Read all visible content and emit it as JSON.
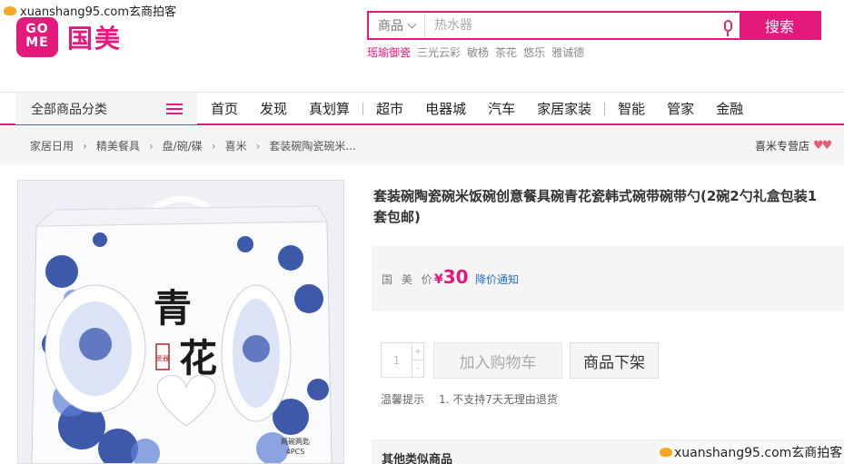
{
  "watermark": {
    "text": "xuanshang95.com玄商拍客"
  },
  "logo": {
    "box_top": "GO",
    "box_bottom": "ME",
    "name": "国美"
  },
  "search": {
    "category": "商品",
    "placeholder": "热水器",
    "button": "搜索"
  },
  "hot_keywords": [
    "瑶瑜御瓷",
    "三光云彩",
    "敏杨",
    "茶花",
    "悠乐",
    "雅诚德"
  ],
  "nav": {
    "all_categories": "全部商品分类",
    "items": [
      "首页",
      "发现",
      "真划算",
      "超市",
      "电器城",
      "汽车",
      "家居家装",
      "智能",
      "管家",
      "金融"
    ]
  },
  "breadcrumb": [
    "家居日用",
    "精美餐具",
    "盘/碗/碟",
    "喜米",
    "套装碗陶瓷碗米..."
  ],
  "store": {
    "name": "喜米专营店"
  },
  "product": {
    "title": "套装碗陶瓷碗米饭碗创意餐具碗青花瓷韩式碗带碗带勺(2碗2勺礼盒包装1套包邮)",
    "price_label": "国 美 价",
    "currency": "¥",
    "price": "30",
    "notify": "降价通知",
    "quantity": "1",
    "add_cart": "加入购物车",
    "off_shelf": "商品下架",
    "tips_label": "温馨提示",
    "tips_text": "1. 不支持7天无理由退货",
    "image_text": {
      "title1": "青",
      "title2": "花",
      "seal": "瓷器",
      "caption": "两碗两匙",
      "count": "4PCS"
    }
  },
  "similar": {
    "title": "其他类似商品"
  },
  "colors": {
    "brand": "#e3197b",
    "link": "#2a72c5"
  }
}
